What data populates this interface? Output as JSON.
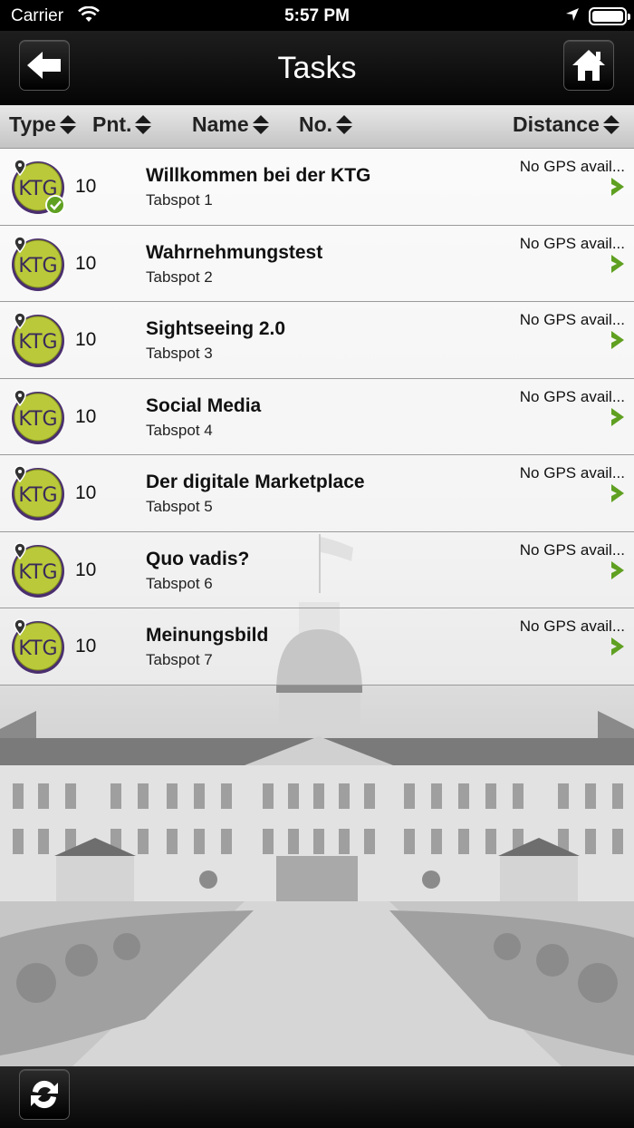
{
  "status_bar": {
    "carrier": "Carrier",
    "time": "5:57 PM"
  },
  "nav": {
    "title": "Tasks",
    "back_icon": "back-arrow-icon",
    "home_icon": "home-icon"
  },
  "columns": {
    "type": "Type",
    "points": "Pnt.",
    "name": "Name",
    "number": "No.",
    "distance": "Distance"
  },
  "tasks": [
    {
      "points": "10",
      "name": "Willkommen bei der KTG",
      "spot": "Tabspot 1",
      "distance": "No GPS avail...",
      "completed": true
    },
    {
      "points": "10",
      "name": "Wahrnehmungstest",
      "spot": "Tabspot 2",
      "distance": "No GPS avail...",
      "completed": false
    },
    {
      "points": "10",
      "name": "Sightseeing 2.0",
      "spot": "Tabspot 3",
      "distance": "No GPS avail...",
      "completed": false
    },
    {
      "points": "10",
      "name": "Social Media",
      "spot": "Tabspot 4",
      "distance": "No GPS avail...",
      "completed": false
    },
    {
      "points": "10",
      "name": "Der digitale Marketplace",
      "spot": "Tabspot 5",
      "distance": "No GPS avail...",
      "completed": false
    },
    {
      "points": "10",
      "name": "Quo vadis?",
      "spot": "Tabspot 6",
      "distance": "No GPS avail...",
      "completed": false
    },
    {
      "points": "10",
      "name": "Meinungsbild",
      "spot": "Tabspot 7",
      "distance": "No GPS avail...",
      "completed": false
    }
  ],
  "colors": {
    "accent_green": "#5fa021",
    "badge_yellow": "#b9c93a",
    "badge_ring": "#4a2e6e"
  }
}
